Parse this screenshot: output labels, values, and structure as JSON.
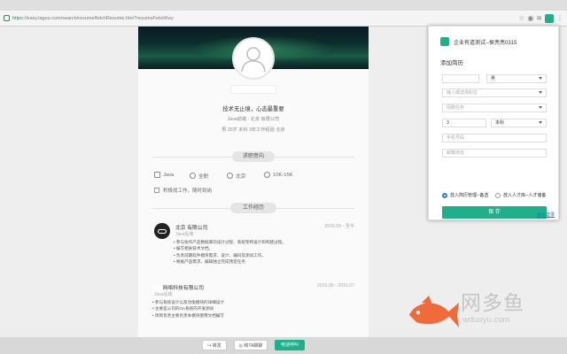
{
  "browser": {
    "url_scheme": "https:",
    "url_rest": "//easy.lagou.com/search/resume/fetchResume.htm?resumeFetchKey"
  },
  "resume": {
    "motto": "技术无止境，心态最重要",
    "meta_line1": "Java前端 · 北京 有限公司",
    "meta_line2": "男 25岁 本科 3年工作经验 北京",
    "section_intent": "求职意向",
    "intent_items": [
      "Java",
      "全职",
      "北京",
      "10K-15K"
    ],
    "intent_checkbox": "积极找工作，随时到岗",
    "section_experience": "工作经历",
    "jobs": [
      {
        "company": "北京 有限公司",
        "role": "Java后端",
        "date": "2016.09 - 至今",
        "bullets": [
          "参与协作产品数据库的设计过程、系统架构设计和构建过程。",
          "编写相关技术文档。",
          "负责前期软件模块需求、设计、编码及测试工作。",
          "根据产品需求，编辑独立完成预定任务"
        ]
      },
      {
        "company": "网络科技有限公司",
        "role": "Java后端",
        "date": "2015.06 - 2016.07",
        "bullets": [
          "参与系统设计以及功能模块的详细设计",
          "主要是公司的OA系统的开发测试",
          "项目负责主要负责本模块使用文档编写"
        ]
      }
    ]
  },
  "bottom_actions": [
    "转发",
    "和TA聊聊",
    "电话呼叫"
  ],
  "watermark": {
    "cn": "网多鱼",
    "en": "wduoyu.com"
  },
  "popup": {
    "header": "企业有道测试--侯亮亮0315",
    "title": "添加简历",
    "gender": "男",
    "position_placeholder": "输入或选择职位",
    "job_placeholder": "招聘任务",
    "years": "3",
    "education": "本科",
    "phone_placeholder": "手机号码",
    "email_placeholder": "邮箱地址",
    "radio1": "放入简历管理--备选",
    "radio2": "放入人才库--人才储备",
    "save": "保 存",
    "logout": "退出登录"
  },
  "colors": {
    "accent": "#1fb08a"
  }
}
